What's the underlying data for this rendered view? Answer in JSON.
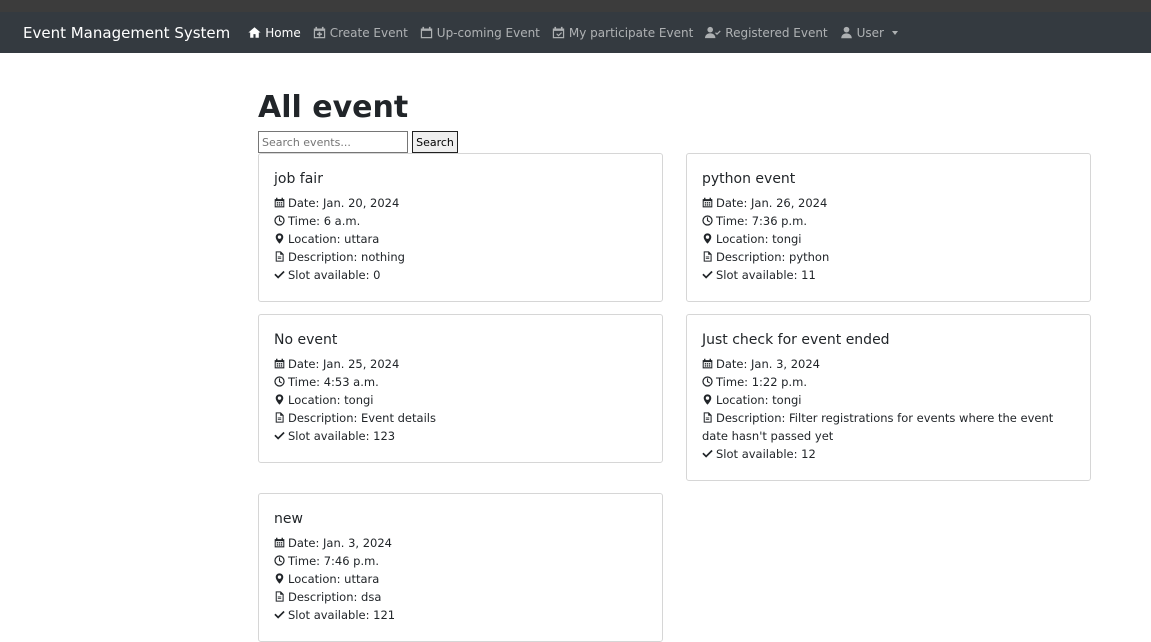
{
  "brand": "Event Management System",
  "nav": [
    {
      "label": "Home",
      "icon": "home-icon"
    },
    {
      "label": "Create Event",
      "icon": "calendar-plus-icon"
    },
    {
      "label": "Up-coming Event",
      "icon": "calendar-icon"
    },
    {
      "label": "My participate Event",
      "icon": "calendar-check-icon"
    },
    {
      "label": "Registered Event",
      "icon": "user-check-icon"
    },
    {
      "label": "User",
      "icon": "user-icon"
    }
  ],
  "page_title": "All event",
  "search": {
    "placeholder": "Search events...",
    "button": "Search"
  },
  "labels": {
    "date": "Date:",
    "time": "Time:",
    "location": "Location:",
    "description": "Description:",
    "slot": "Slot available:"
  },
  "events": [
    {
      "title": "job fair",
      "date": "Jan. 20, 2024",
      "time": "6 a.m.",
      "location": "uttara",
      "description": "nothing",
      "slot": "0"
    },
    {
      "title": "python event",
      "date": "Jan. 26, 2024",
      "time": "7:36 p.m.",
      "location": "tongi",
      "description": "python",
      "slot": "11"
    },
    {
      "title": "No event",
      "date": "Jan. 25, 2024",
      "time": "4:53 a.m.",
      "location": "tongi",
      "description": "Event details",
      "slot": "123"
    },
    {
      "title": "Just check for event ended",
      "date": "Jan. 3, 2024",
      "time": "1:22 p.m.",
      "location": "tongi",
      "description": "Filter registrations for events where the event date hasn't passed yet",
      "slot": "12"
    },
    {
      "title": "new",
      "date": "Jan. 3, 2024",
      "time": "7:46 p.m.",
      "location": "uttara",
      "description": "dsa",
      "slot": "121"
    }
  ],
  "colors": {
    "navbar": "#343a40",
    "nav_active": "#ffffff",
    "nav_inactive": "rgba(255,255,255,0.6)"
  }
}
